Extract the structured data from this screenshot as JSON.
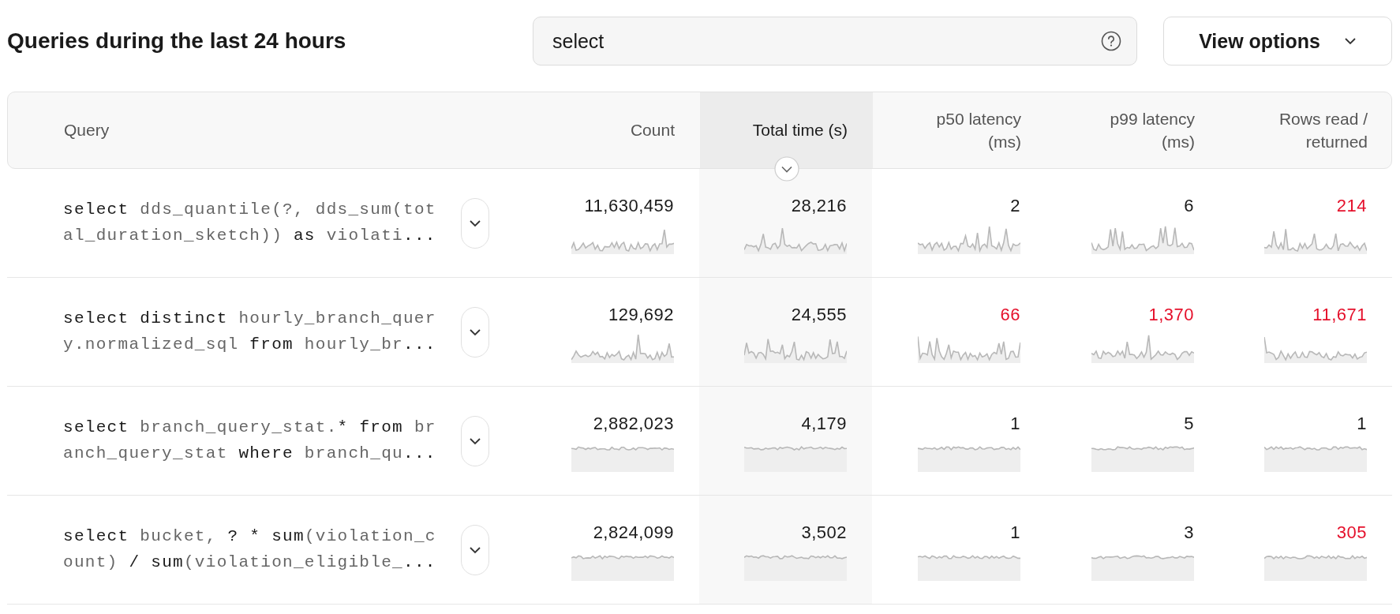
{
  "title": "Queries during the last 24 hours",
  "search": {
    "value": "select"
  },
  "view_options": {
    "label": "View options"
  },
  "columns": [
    {
      "label": "Query",
      "sorted": false
    },
    {
      "label": "Count",
      "sorted": false
    },
    {
      "label": "Total time (s)",
      "sorted": true
    },
    {
      "label": "p50 latency (ms)",
      "sorted": false
    },
    {
      "label": "p99 latency (ms)",
      "sorted": false
    },
    {
      "label": "Rows read / returned",
      "sorted": false
    }
  ],
  "rows": [
    {
      "query": [
        {
          "kind": "keyword",
          "text": "select "
        },
        {
          "kind": "ident",
          "text": "dds_quantile(?, dds_sum(total_duration_sketch))"
        },
        {
          "kind": "keyword",
          "text": " as "
        },
        {
          "kind": "ident",
          "text": "violati"
        },
        {
          "kind": "keyword",
          "text": "..."
        }
      ],
      "cells": [
        {
          "value": "11,630,459",
          "alert": false
        },
        {
          "value": "28,216",
          "alert": false
        },
        {
          "value": "2",
          "alert": false
        },
        {
          "value": "6",
          "alert": false
        },
        {
          "value": "214",
          "alert": true
        }
      ]
    },
    {
      "query": [
        {
          "kind": "keyword",
          "text": "select distinct "
        },
        {
          "kind": "ident",
          "text": "hourly_branch_query.normalized_sql"
        },
        {
          "kind": "keyword",
          "text": " from "
        },
        {
          "kind": "ident",
          "text": "hourly_br"
        },
        {
          "kind": "keyword",
          "text": "..."
        }
      ],
      "cells": [
        {
          "value": "129,692",
          "alert": false
        },
        {
          "value": "24,555",
          "alert": false
        },
        {
          "value": "66",
          "alert": true
        },
        {
          "value": "1,370",
          "alert": true
        },
        {
          "value": "11,671",
          "alert": true
        }
      ]
    },
    {
      "query": [
        {
          "kind": "keyword",
          "text": "select "
        },
        {
          "kind": "ident",
          "text": "branch_query_stat."
        },
        {
          "kind": "keyword",
          "text": "* from "
        },
        {
          "kind": "ident",
          "text": "branch_query_stat"
        },
        {
          "kind": "keyword",
          "text": " where "
        },
        {
          "kind": "ident",
          "text": "branch_qu"
        },
        {
          "kind": "keyword",
          "text": "..."
        }
      ],
      "cells": [
        {
          "value": "2,882,023",
          "alert": false
        },
        {
          "value": "4,179",
          "alert": false
        },
        {
          "value": "1",
          "alert": false
        },
        {
          "value": "5",
          "alert": false
        },
        {
          "value": "1",
          "alert": false
        }
      ]
    },
    {
      "query": [
        {
          "kind": "keyword",
          "text": "select "
        },
        {
          "kind": "ident",
          "text": "bucket, "
        },
        {
          "kind": "keyword",
          "text": "? * sum"
        },
        {
          "kind": "ident",
          "text": "(violation_count) "
        },
        {
          "kind": "keyword",
          "text": "/ sum"
        },
        {
          "kind": "ident",
          "text": "(violation_eligible_"
        },
        {
          "kind": "keyword",
          "text": "..."
        }
      ],
      "cells": [
        {
          "value": "2,824,099",
          "alert": false
        },
        {
          "value": "3,502",
          "alert": false
        },
        {
          "value": "1",
          "alert": false
        },
        {
          "value": "3",
          "alert": false
        },
        {
          "value": "305",
          "alert": true
        }
      ]
    }
  ]
}
